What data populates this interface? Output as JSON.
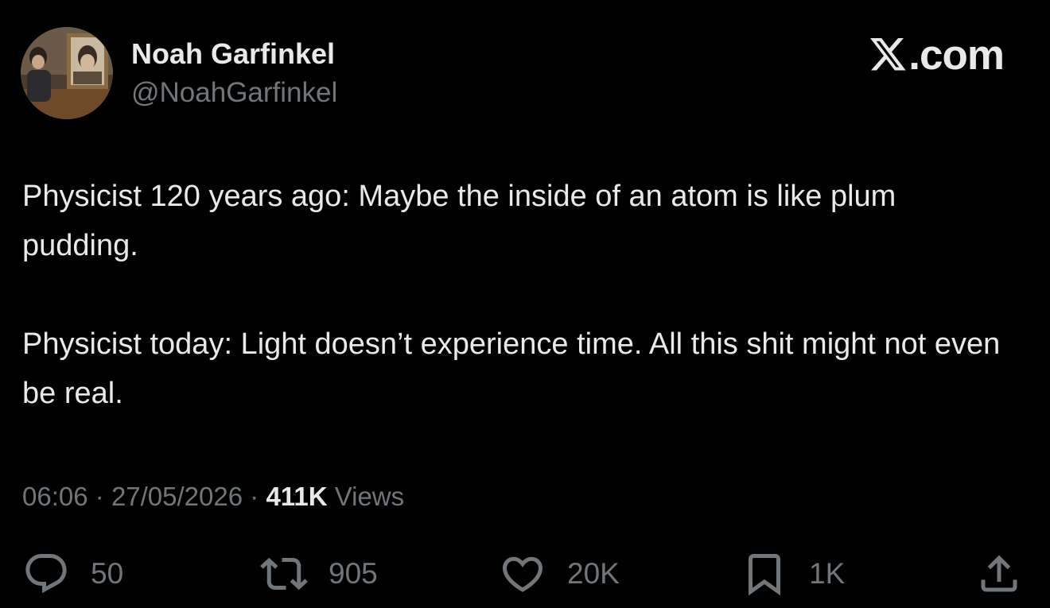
{
  "author": {
    "display_name": "Noah Garfinkel",
    "handle": "@NoahGarfinkel",
    "avatar_icon": "profile-photo"
  },
  "brand": {
    "logo_icon": "x-logo-icon",
    "text": ".com"
  },
  "post": {
    "paragraphs": [
      "Physicist 120 years ago: Maybe the inside of an atom is like plum pudding.",
      "Physicist today: Light doesn’t experience time. All this shit might not even be real."
    ]
  },
  "meta": {
    "time": "06:06",
    "separator": "·",
    "date": "27/05/2026",
    "views_count": "411K",
    "views_label": "Views"
  },
  "actions": {
    "reply": {
      "icon": "reply-icon",
      "count": "50"
    },
    "repost": {
      "icon": "repost-icon",
      "count": "905"
    },
    "like": {
      "icon": "heart-icon",
      "count": "20K"
    },
    "bookmark": {
      "icon": "bookmark-icon",
      "count": "1K"
    },
    "share": {
      "icon": "share-icon"
    }
  },
  "colors": {
    "background": "#000000",
    "primary_text": "#e7e9ea",
    "secondary_text": "#71767b"
  }
}
